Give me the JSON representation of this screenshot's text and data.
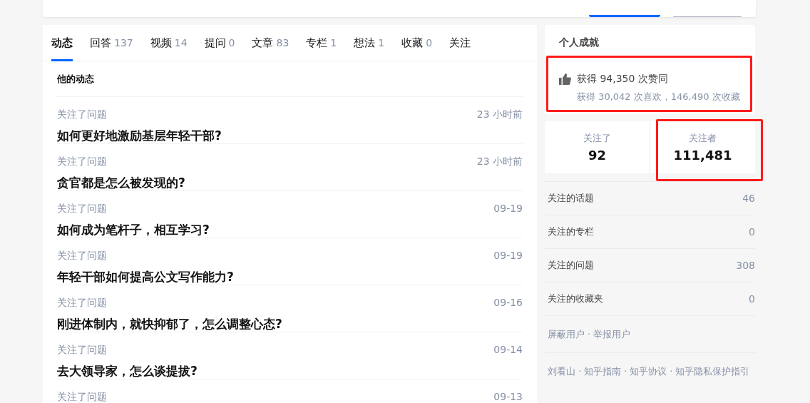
{
  "header_buttons": [
    {
      "kind": "primary"
    },
    {
      "kind": "secondary"
    }
  ],
  "tabs": [
    {
      "label": "动态",
      "selected": true
    },
    {
      "label": "回答",
      "count": "137",
      "selected": false
    },
    {
      "label": "视频",
      "count": "14",
      "selected": false
    },
    {
      "label": "提问",
      "count": "0",
      "selected": false
    },
    {
      "label": "文章",
      "count": "83",
      "selected": false
    },
    {
      "label": "专栏",
      "count": "1",
      "selected": false
    },
    {
      "label": "想法",
      "count": "1",
      "selected": false
    },
    {
      "label": "收藏",
      "count": "0",
      "selected": false
    },
    {
      "label": "关注",
      "selected": false
    }
  ],
  "feed": {
    "title": "他的动态",
    "items": [
      {
        "action": "关注了问题",
        "time": "23 小时前",
        "title": "如何更好地激励基层年轻干部?"
      },
      {
        "action": "关注了问题",
        "time": "23 小时前",
        "title": "贪官都是怎么被发现的?"
      },
      {
        "action": "关注了问题",
        "time": "09-19",
        "title": "如何成为笔杆子，相互学习?"
      },
      {
        "action": "关注了问题",
        "time": "09-19",
        "title": "年轻干部如何提高公文写作能力?"
      },
      {
        "action": "关注了问题",
        "time": "09-16",
        "title": "刚进体制内，就快抑郁了，怎么调整心态?"
      },
      {
        "action": "关注了问题",
        "time": "09-14",
        "title": "去大领导家，怎么谈提拔?"
      },
      {
        "action": "关注了问题",
        "time": "09-13"
      }
    ]
  },
  "achievements": {
    "title": "个人成就",
    "highlighted": true,
    "upvotes": "获得 94,350 次赞同",
    "detail": "获得 30,042 次喜欢，146,490 次收藏"
  },
  "stats": [
    {
      "label": "关注了",
      "value": "92",
      "highlighted": false
    },
    {
      "label": "关注者",
      "value": "111,481",
      "highlighted": true
    }
  ],
  "follow_list": [
    {
      "label": "关注的话题",
      "count": "46"
    },
    {
      "label": "关注的专栏",
      "count": "0"
    },
    {
      "label": "关注的问题",
      "count": "308"
    },
    {
      "label": "关注的收藏夹",
      "count": "0"
    }
  ],
  "footer_separator": "·",
  "footer_links": [
    [
      "屏蔽用户",
      "举报用户"
    ],
    [
      "刘看山",
      "知乎指南",
      "知乎协议",
      "知乎隐私保护指引"
    ]
  ]
}
